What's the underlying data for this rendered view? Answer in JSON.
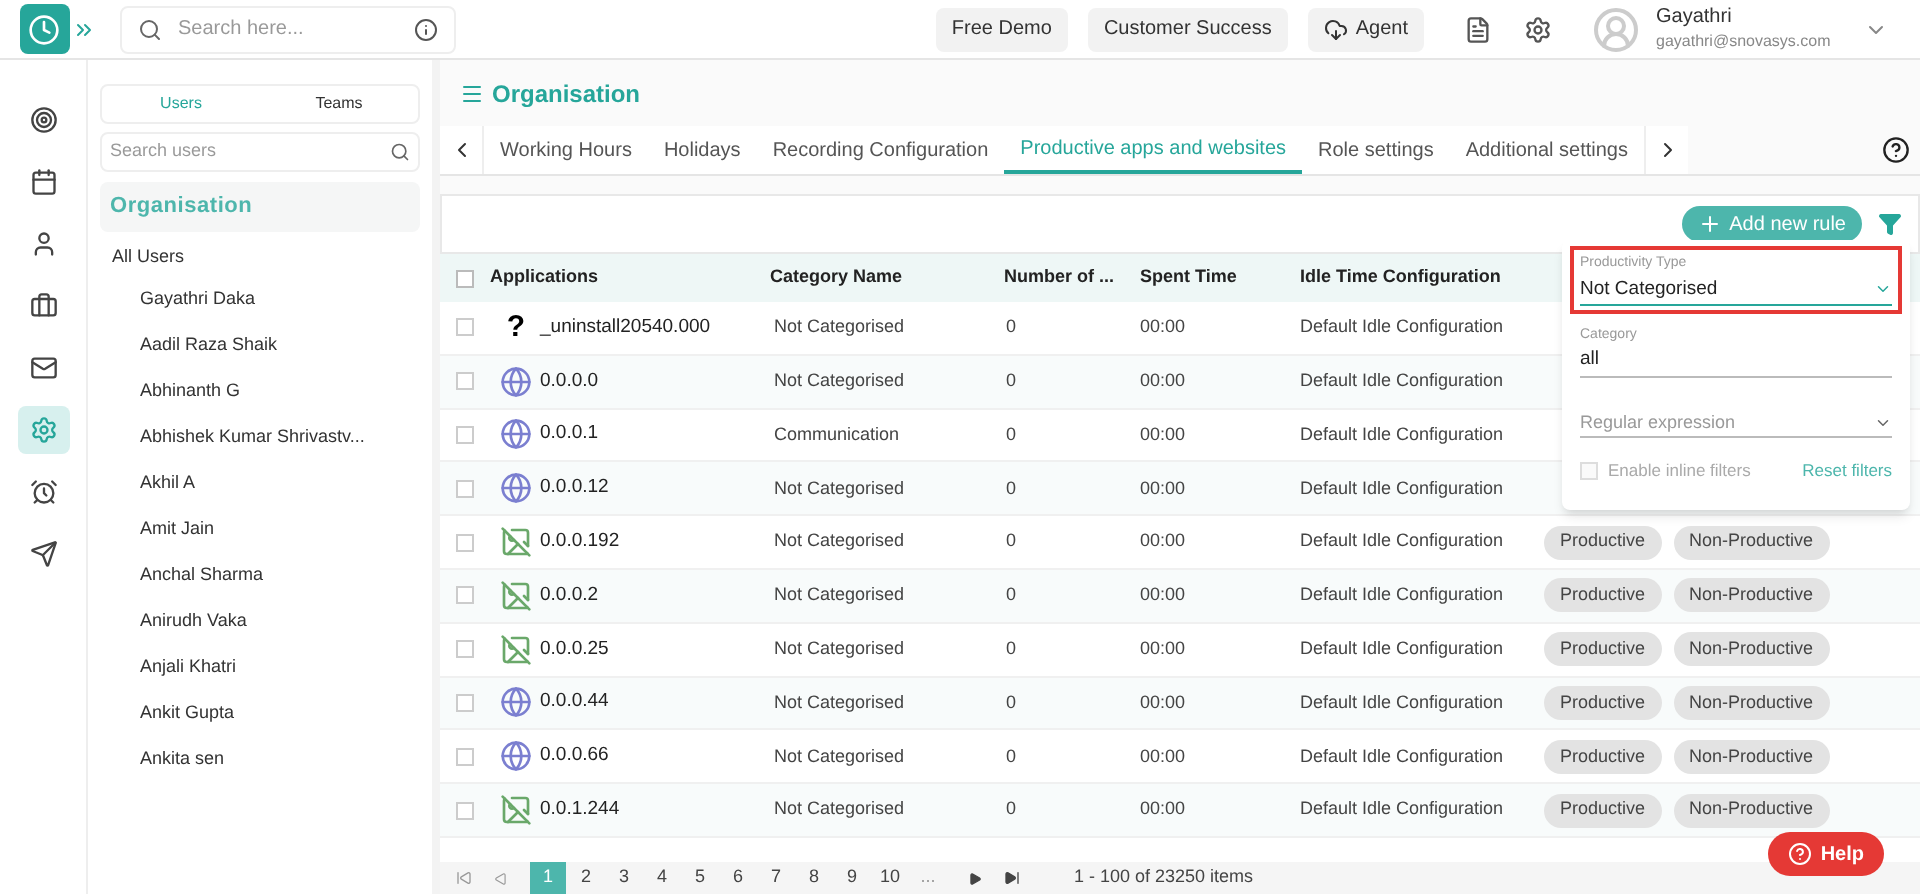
{
  "topbar": {
    "search": {
      "placeholder": "Search here..."
    },
    "buttons": [
      "Free Demo",
      "Customer Success",
      "Agent"
    ],
    "user": {
      "name": "Gayathri",
      "email": "gayathri@snovasys.com"
    }
  },
  "rail": [
    {
      "selected": false
    },
    {
      "selected": false
    },
    {
      "selected": false
    },
    {
      "selected": false
    },
    {
      "selected": false
    },
    {
      "selected": true
    },
    {
      "selected": false
    },
    {
      "selected": false
    }
  ],
  "users_panel": {
    "tabs": [
      {
        "label": "Users",
        "selected": true
      },
      {
        "label": "Teams",
        "selected": false
      }
    ],
    "search": {
      "placeholder": "Search users"
    },
    "heading": "Organisation",
    "all_label": "All Users",
    "users": [
      "Gayathri Daka",
      "Aadil Raza Shaik",
      "Abhinanth G",
      "Abhishek Kumar Shrivastv...",
      "Akhil A",
      "Amit Jain",
      "Anchal Sharma",
      "Anirudh Vaka",
      "Anjali Khatri",
      "Ankit Gupta",
      "Ankita sen"
    ]
  },
  "main": {
    "title": "Organisation",
    "tabs": [
      {
        "label": "Working Hours",
        "selected": false
      },
      {
        "label": "Holidays",
        "selected": false
      },
      {
        "label": "Recording Configuration",
        "selected": false
      },
      {
        "label": "Productive apps and websites",
        "selected": true
      },
      {
        "label": "Role settings",
        "selected": false
      },
      {
        "label": "Additional settings",
        "selected": false
      }
    ],
    "add_button": "Add new rule",
    "table": {
      "all_checked": false,
      "columns": [
        "Applications",
        "Category Name",
        "Number of ...",
        "Spent Time",
        "Idle Time Configuration"
      ],
      "rows": [
        {
          "kind": "glyph",
          "glyph": "?",
          "app": "_uninstall20540.000",
          "category": "Not Categorised",
          "number": "0",
          "spent": "00:00",
          "idle": "Default Idle Configuration",
          "checked": false
        },
        {
          "kind": "website",
          "app": "0.0.0.0",
          "category": "Not Categorised",
          "number": "0",
          "spent": "00:00",
          "idle": "Default Idle Configuration",
          "checked": false
        },
        {
          "kind": "website",
          "app": "0.0.0.1",
          "category": "Communication",
          "number": "0",
          "spent": "00:00",
          "idle": "Default Idle Configuration",
          "checked": false
        },
        {
          "kind": "website",
          "app": "0.0.0.12",
          "category": "Not Categorised",
          "number": "0",
          "spent": "00:00",
          "idle": "Default Idle Configuration",
          "checked": false
        },
        {
          "kind": "missing",
          "app": "0.0.0.192",
          "category": "Not Categorised",
          "number": "0",
          "spent": "00:00",
          "idle": "Default Idle Configuration",
          "checked": false,
          "actions": [
            "Productive",
            "Non-Productive"
          ]
        },
        {
          "kind": "missing",
          "app": "0.0.0.2",
          "category": "Not Categorised",
          "number": "0",
          "spent": "00:00",
          "idle": "Default Idle Configuration",
          "checked": false,
          "actions": [
            "Productive",
            "Non-Productive"
          ]
        },
        {
          "kind": "missing",
          "app": "0.0.0.25",
          "category": "Not Categorised",
          "number": "0",
          "spent": "00:00",
          "idle": "Default Idle Configuration",
          "checked": false,
          "actions": [
            "Productive",
            "Non-Productive"
          ]
        },
        {
          "kind": "website",
          "app": "0.0.0.44",
          "category": "Not Categorised",
          "number": "0",
          "spent": "00:00",
          "idle": "Default Idle Configuration",
          "checked": false,
          "actions": [
            "Productive",
            "Non-Productive"
          ]
        },
        {
          "kind": "website",
          "app": "0.0.0.66",
          "category": "Not Categorised",
          "number": "0",
          "spent": "00:00",
          "idle": "Default Idle Configuration",
          "checked": false,
          "actions": [
            "Productive",
            "Non-Productive"
          ]
        },
        {
          "kind": "missing",
          "app": "0.0.1.244",
          "category": "Not Categorised",
          "number": "0",
          "spent": "00:00",
          "idle": "Default Idle Configuration",
          "checked": false,
          "actions": [
            "Productive",
            "Non-Productive"
          ]
        }
      ]
    },
    "pager": {
      "pages": [
        {
          "label": "1",
          "selected": true
        },
        {
          "label": "2",
          "selected": false
        },
        {
          "label": "3",
          "selected": false
        },
        {
          "label": "4",
          "selected": false
        },
        {
          "label": "5",
          "selected": false
        },
        {
          "label": "6",
          "selected": false
        },
        {
          "label": "7",
          "selected": false
        },
        {
          "label": "8",
          "selected": false
        },
        {
          "label": "9",
          "selected": false
        },
        {
          "label": "10",
          "selected": false
        }
      ],
      "more": "...",
      "summary": "1 - 100 of 23250 items"
    },
    "filter": {
      "productivity_label": "Productivity Type",
      "productivity_value": "Not Categorised",
      "highlighted": true,
      "category_label": "Category",
      "category_value": "all",
      "regex_placeholder": "Regular expression",
      "inline_label": "Enable inline filters",
      "inline_checked": false,
      "reset": "Reset filters"
    }
  },
  "help": "Help"
}
